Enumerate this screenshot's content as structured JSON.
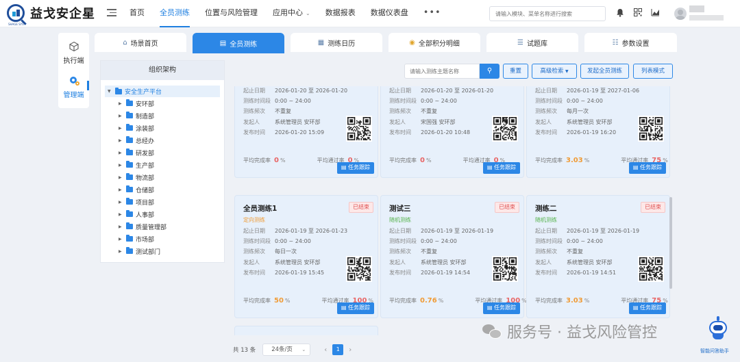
{
  "header": {
    "brand": "益戈安企星",
    "brand_sub": "SHAGE SYS",
    "nav": [
      {
        "label": "首页",
        "active": false
      },
      {
        "label": "全员测练",
        "active": true
      },
      {
        "label": "位置与风险管理",
        "active": false
      },
      {
        "label": "应用中心",
        "active": false,
        "has_dropdown": true
      },
      {
        "label": "数据报表",
        "active": false
      },
      {
        "label": "数据仪表盘",
        "active": false
      },
      {
        "label": "•••",
        "active": false
      }
    ],
    "search_placeholder": "请输入模块、菜单名称进行搜索",
    "icons": [
      "bell-icon",
      "qrcode-icon",
      "chart-icon"
    ]
  },
  "sidebar": {
    "items": [
      {
        "label": "执行端",
        "icon": "cube-icon",
        "active": false
      },
      {
        "label": "管理端",
        "icon": "gear-icon",
        "active": true
      }
    ]
  },
  "tabs": [
    {
      "label": "场景首页",
      "icon": "home-icon",
      "active": false
    },
    {
      "label": "全员测练",
      "icon": "document-icon",
      "active": true
    },
    {
      "label": "测练日历",
      "icon": "calendar-icon",
      "active": false
    },
    {
      "label": "全部积分明细",
      "icon": "points-icon",
      "active": false
    },
    {
      "label": "试题库",
      "icon": "list-icon",
      "active": false
    },
    {
      "label": "参数设置",
      "icon": "sliders-icon",
      "active": false
    }
  ],
  "org": {
    "title": "组织架构",
    "root": "安全生产平台",
    "departments": [
      "安环部",
      "制造部",
      "涂装部",
      "总经办",
      "研发部",
      "生产部",
      "物流部",
      "仓储部",
      "项目部",
      "人事部",
      "质量管理部",
      "市场部",
      "测试部门"
    ]
  },
  "toolbar": {
    "search_placeholder": "请输入测练主题名称",
    "reset": "重置",
    "advanced": "高级检索",
    "launch": "发起全员测练",
    "list_mode": "列表模式"
  },
  "labels": {
    "date": "起止日期",
    "time": "测练时间段",
    "freq": "测练频次",
    "initiator": "发起人",
    "publish": "发布时间",
    "avg_complete": "平均完成率",
    "avg_pass": "平均通过率",
    "unit": "%",
    "follow": "任务跟踪"
  },
  "cards": [
    {
      "title": "",
      "badge": "",
      "type": "",
      "date": "2026-01-20 至 2026-01-20",
      "time": "0:00 ~ 24:00",
      "freq": "不重复",
      "initiator": "系统管理员  安环部",
      "publish": "2026-01-20 15:09",
      "complete": "0",
      "pass": "0"
    },
    {
      "title": "",
      "badge": "",
      "type": "",
      "date": "2026-01-20 至 2026-01-20",
      "time": "0:00 ~ 24:00",
      "freq": "不重复",
      "initiator": "宋国强  安环部",
      "publish": "2026-01-20 10:48",
      "complete": "0",
      "pass": "0"
    },
    {
      "title": "",
      "badge": "",
      "type": "",
      "date": "2026-01-19 至 2027-01-06",
      "time": "0:00 ~ 24:00",
      "freq": "每月一次",
      "initiator": "系统管理员  安环部",
      "publish": "2026-01-19 16:20",
      "complete": "3.03",
      "pass": "75"
    },
    {
      "title": "全员测练1",
      "badge": "已结束",
      "type": "定向测练",
      "date": "2026-01-19 至 2026-01-23",
      "time": "0:00 ~ 24:00",
      "freq": "每日一次",
      "initiator": "系统管理员  安环部",
      "publish": "2026-01-19 15:45",
      "complete": "50",
      "pass": "100"
    },
    {
      "title": "测试三",
      "badge": "已结束",
      "type": "随机测练",
      "date": "2026-01-19 至 2026-01-19",
      "time": "0:00 ~ 24:00",
      "freq": "不重复",
      "initiator": "系统管理员  安环部",
      "publish": "2026-01-19 14:54",
      "complete": "0.76",
      "pass": "100"
    },
    {
      "title": "测练二",
      "badge": "已结束",
      "type": "随机测练",
      "date": "2026-01-19 至 2026-01-19",
      "time": "0:00 ~ 24:00",
      "freq": "不重复",
      "initiator": "系统管理员  安环部",
      "publish": "2026-01-19 14:51",
      "complete": "3.03",
      "pass": "75"
    }
  ],
  "pager": {
    "total": "共 13 条",
    "page_size": "24条/页",
    "current": "1"
  },
  "watermark": "服务号 · 益戈风险管控",
  "assistant_label": "智能问答助手"
}
